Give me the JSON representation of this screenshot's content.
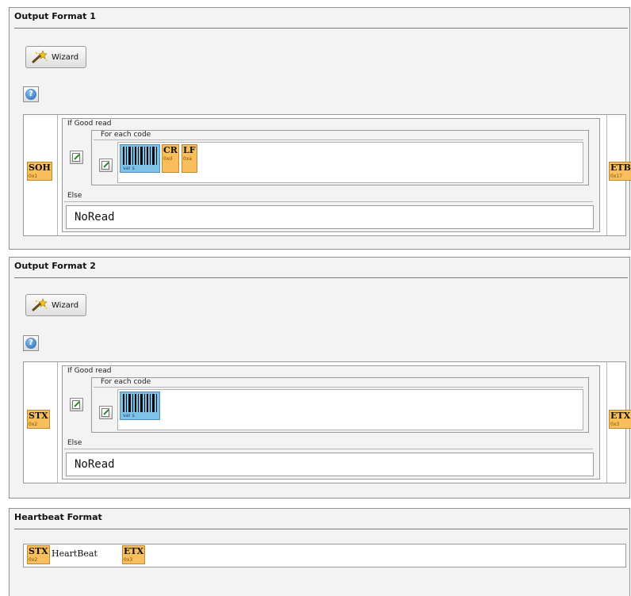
{
  "output_format_1": {
    "title": "Output Format 1",
    "wizard_label": "Wizard",
    "help_glyph": "?",
    "prefix": {
      "sym": "SOH",
      "hex": "0x1"
    },
    "suffix": {
      "sym": "ETB",
      "hex": "0x17"
    },
    "if_label": "If Good read",
    "foreach_label": "For each code",
    "barcode_label": "var s",
    "code_tokens": [
      {
        "sym": "CR",
        "hex": "0xd"
      },
      {
        "sym": "LF",
        "hex": "0xa"
      }
    ],
    "else_label": "Else",
    "else_value": "NoRead"
  },
  "output_format_2": {
    "title": "Output Format 2",
    "wizard_label": "Wizard",
    "help_glyph": "?",
    "prefix": {
      "sym": "STX",
      "hex": "0x2"
    },
    "suffix": {
      "sym": "ETX",
      "hex": "0x3"
    },
    "if_label": "If Good read",
    "foreach_label": "For each code",
    "barcode_label": "var s",
    "else_label": "Else",
    "else_value": "NoRead"
  },
  "heartbeat_format": {
    "title": "Heartbeat Format",
    "prefix": {
      "sym": "STX",
      "hex": "0x2"
    },
    "text": "HeartBeat",
    "suffix": {
      "sym": "ETX",
      "hex": "0x3"
    }
  },
  "icons": [
    "wand-icon",
    "help-icon",
    "edit-icon",
    "barcode-icon"
  ],
  "colors": {
    "token_bg": "#f9bf5c",
    "barcode_bg": "#7fc2e8",
    "panel_bg": "#f3f3f3"
  }
}
